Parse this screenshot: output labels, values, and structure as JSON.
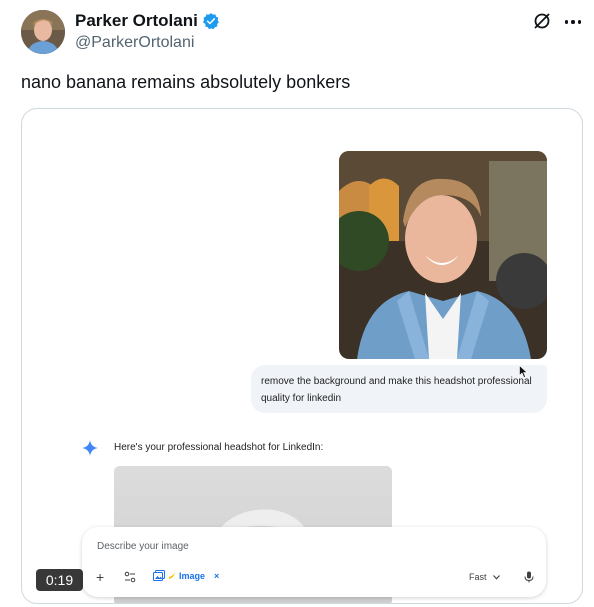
{
  "author": {
    "display_name": "Parker Ortolani",
    "handle": "@ParkerOrtolani"
  },
  "tweet": {
    "text": "nano banana remains absolutely bonkers"
  },
  "video": {
    "timestamp": "0:19"
  },
  "gemini_ui": {
    "user_prompt": "remove the background and make this headshot professional quality for linkedin",
    "assistant_reply": "Here's your professional headshot for LinkedIn:",
    "input_placeholder": "Describe your image",
    "chip_label": "Image",
    "chip_close": "×",
    "model_label": "Fast",
    "plus_label": "+"
  },
  "colors": {
    "verified": "#1d9bf0",
    "chip": "#1a73e8",
    "handle": "#536471"
  }
}
